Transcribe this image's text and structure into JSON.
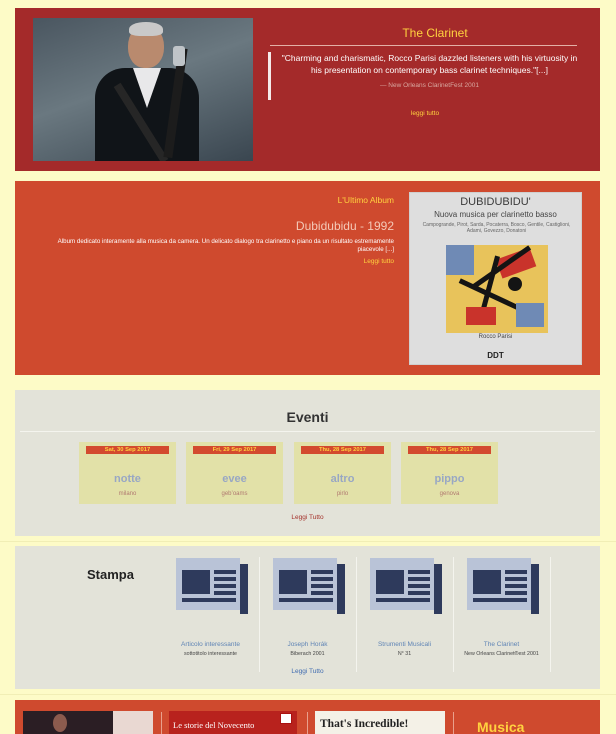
{
  "clarinet": {
    "title": "The Clarinet",
    "quote": "\"Charming and charismatic, Rocco Parisi dazzled listeners with his virtuosity in his presentation on contemporary bass clarinet techniques.\"[...]",
    "source": "— New Orleans ClarinetFest 2001",
    "more": "leggi tutto"
  },
  "album": {
    "label": "L'Ultimo Album",
    "title": "Dubidubidu - 1992",
    "description": "Album dedicato interamente alla musica da camera. Un delicato dialogo tra clarinetto e piano da un risultato estremamente piacevole [...]",
    "more": "Leggi tutto",
    "cover": {
      "title": "DUBIDUBIDU'",
      "subtitle": "Nuova musica per clarinetto basso",
      "composers": "Campogrande, Pirot, Sarda, Pocaterra, Bosco, Gentile, Castiglioni, Adami, Govezzo, Donatoni",
      "artist": "Rocco Parisi",
      "label": "DDT"
    }
  },
  "eventi": {
    "title": "Eventi",
    "items": [
      {
        "date": "Sat, 30 Sep 2017",
        "name": "notte",
        "place": "milano"
      },
      {
        "date": "Fri, 29 Sep 2017",
        "name": "evee",
        "place": "gebʼoams"
      },
      {
        "date": "Thu, 28 Sep 2017",
        "name": "altro",
        "place": "pirlo"
      },
      {
        "date": "Thu, 28 Sep 2017",
        "name": "pippo",
        "place": "genova"
      }
    ],
    "more": "Leggi Tutto"
  },
  "stampa": {
    "title": "Stampa",
    "items": [
      {
        "label": "Articolo interessante",
        "sub": "sottotitolo interessante"
      },
      {
        "label": "Joseph Horák",
        "sub": "Biberach 2001"
      },
      {
        "label": "Strumenti Musicali",
        "sub": "N° 31"
      },
      {
        "label": "The Clarinet",
        "sub": "New Orleans Clarinet®est 2001"
      }
    ],
    "more": "Leggi Tutto"
  },
  "musica": {
    "thumb_b": "Le storie del Novecento",
    "thumb_c": "That's Incredible!",
    "title": "Musica"
  },
  "colors": {
    "background": "#fdfbc7",
    "clarinet_panel": "#a42a2a",
    "album_panel": "#cf4a2e",
    "grey_panel": "#e3e3d9",
    "accent_yellow": "#ffd23f",
    "press_icon": "#2e3a5c"
  }
}
